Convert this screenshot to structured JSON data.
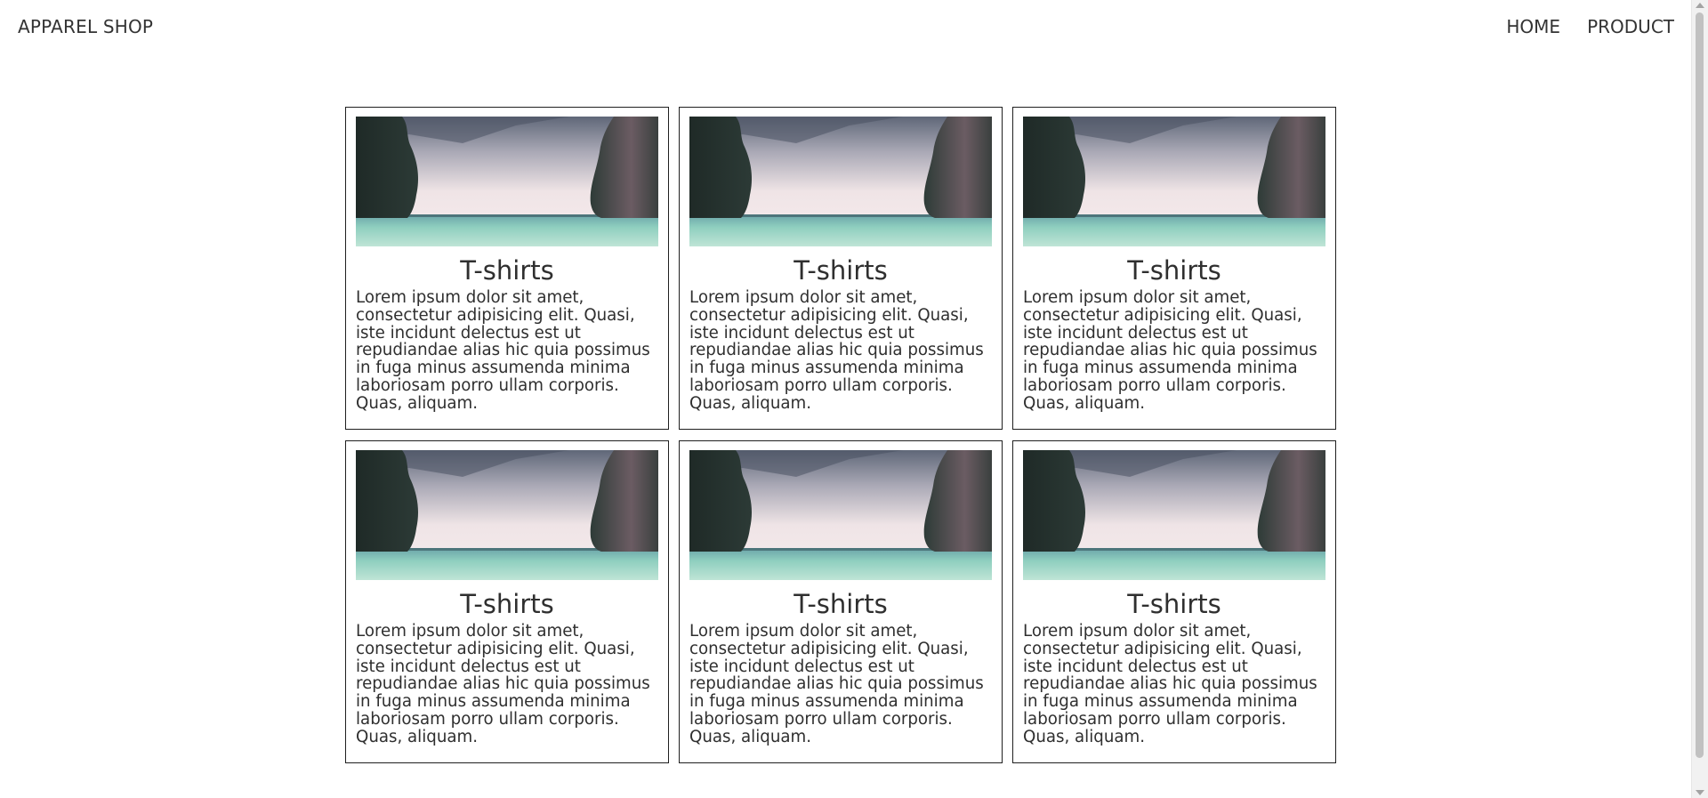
{
  "header": {
    "brand": "APPAREL SHOP",
    "nav": [
      {
        "label": "HOME"
      },
      {
        "label": "PRODUCT"
      }
    ]
  },
  "cards": [
    {
      "title": "T-shirts",
      "description": "Lorem ipsum dolor sit amet, consectetur adipisicing elit. Quasi, iste incidunt delectus est ut repudiandae alias hic quia possimus in fuga minus assumenda minima laboriosam porro ullam corporis. Quas, aliquam."
    },
    {
      "title": "T-shirts",
      "description": "Lorem ipsum dolor sit amet, consectetur adipisicing elit. Quasi, iste incidunt delectus est ut repudiandae alias hic quia possimus in fuga minus assumenda minima laboriosam porro ullam corporis. Quas, aliquam."
    },
    {
      "title": "T-shirts",
      "description": "Lorem ipsum dolor sit amet, consectetur adipisicing elit. Quasi, iste incidunt delectus est ut repudiandae alias hic quia possimus in fuga minus assumenda minima laboriosam porro ullam corporis. Quas, aliquam."
    },
    {
      "title": "T-shirts",
      "description": "Lorem ipsum dolor sit amet, consectetur adipisicing elit. Quasi, iste incidunt delectus est ut repudiandae alias hic quia possimus in fuga minus assumenda minima laboriosam porro ullam corporis. Quas, aliquam."
    },
    {
      "title": "T-shirts",
      "description": "Lorem ipsum dolor sit amet, consectetur adipisicing elit. Quasi, iste incidunt delectus est ut repudiandae alias hic quia possimus in fuga minus assumenda minima laboriosam porro ullam corporis. Quas, aliquam."
    },
    {
      "title": "T-shirts",
      "description": "Lorem ipsum dolor sit amet, consectetur adipisicing elit. Quasi, iste incidunt delectus est ut repudiandae alias hic quia possimus in fuga minus assumenda minima laboriosam porro ullam corporis. Quas, aliquam."
    }
  ],
  "colors": {
    "border": "#1f1f1f",
    "text": "#2f2f2f",
    "sky_top": "#5f6778",
    "sky_bottom": "#efe4e6",
    "water": "#8fcfbf",
    "rock": "#2c3a36"
  }
}
